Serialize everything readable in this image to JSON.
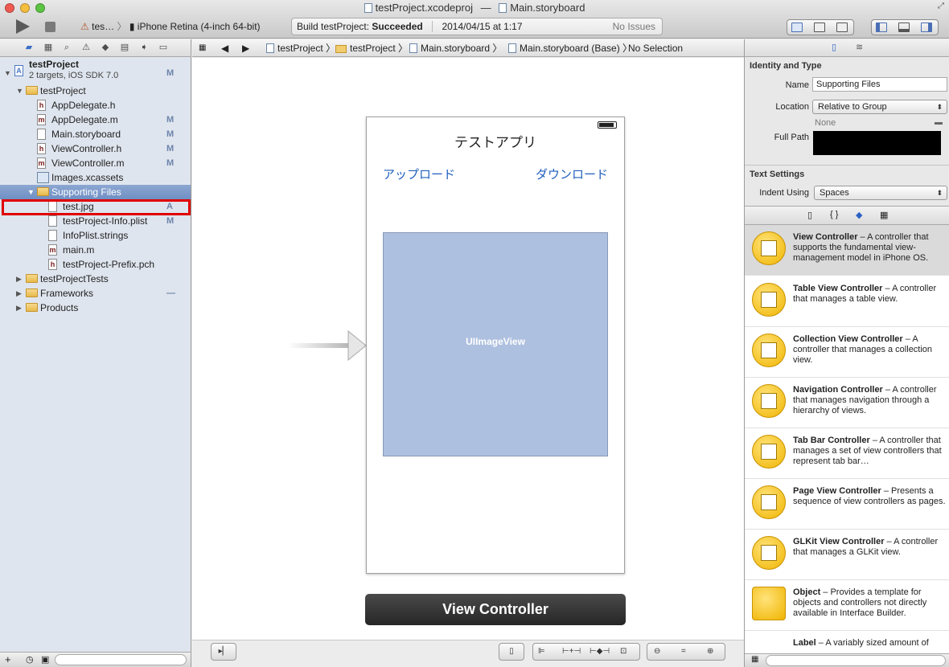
{
  "window": {
    "project_file": "testProject.xcodeproj",
    "separator": "—",
    "storyboard_file": "Main.storyboard"
  },
  "toolbar": {
    "scheme": "tes…",
    "destination": "iPhone Retina (4-inch 64-bit)",
    "status_prefix": "Build testProject: ",
    "status_result": "Succeeded",
    "status_time": "2014/04/15 at 1:17",
    "issues": "No Issues"
  },
  "navigator": {
    "project_name": "testProject",
    "project_sub": "2 targets, iOS SDK 7.0",
    "project_badge": "M",
    "items": [
      {
        "label": "testProject",
        "badge": ""
      },
      {
        "label": "AppDelegate.h",
        "badge": "",
        "icon": "h"
      },
      {
        "label": "AppDelegate.m",
        "badge": "M",
        "icon": "m"
      },
      {
        "label": "Main.storyboard",
        "badge": "M"
      },
      {
        "label": "ViewController.h",
        "badge": "M",
        "icon": "h"
      },
      {
        "label": "ViewController.m",
        "badge": "M",
        "icon": "m"
      },
      {
        "label": "Images.xcassets",
        "badge": ""
      },
      {
        "label": "Supporting Files",
        "badge": ""
      },
      {
        "label": "test.jpg",
        "badge": "A"
      },
      {
        "label": "testProject-Info.plist",
        "badge": "M"
      },
      {
        "label": "InfoPlist.strings",
        "badge": ""
      },
      {
        "label": "main.m",
        "badge": "",
        "icon": "m"
      },
      {
        "label": "testProject-Prefix.pch",
        "badge": "",
        "icon": "h"
      },
      {
        "label": "testProjectTests",
        "badge": ""
      },
      {
        "label": "Frameworks",
        "badge": "—"
      },
      {
        "label": "Products",
        "badge": ""
      }
    ]
  },
  "jumpbar": {
    "crumbs": [
      "testProject",
      "testProject",
      "Main.storyboard",
      "Main.storyboard (Base)",
      "No Selection"
    ]
  },
  "canvas": {
    "nav_title": "テストアプリ",
    "upload": "アップロード",
    "download": "ダウンロード",
    "image_view": "UIImageView",
    "scene_label": "View Controller"
  },
  "inspector": {
    "identity_type": "Identity and Type",
    "name_label": "Name",
    "name_value": "Supporting Files",
    "location_label": "Location",
    "location_value": "Relative to Group",
    "none": "None",
    "full_path_label": "Full Path",
    "text_settings": "Text Settings",
    "indent_label": "Indent Using",
    "indent_value": "Spaces"
  },
  "library": [
    {
      "title": "View Controller",
      "desc": " – A controller that supports the fundamental view-management model in iPhone OS."
    },
    {
      "title": "Table View Controller",
      "desc": " – A controller that manages a table view."
    },
    {
      "title": "Collection View Controller",
      "desc": " – A controller that manages a collection view."
    },
    {
      "title": "Navigation Controller",
      "desc": " – A controller that manages navigation through a hierarchy of views."
    },
    {
      "title": "Tab Bar Controller",
      "desc": " – A controller that manages a set of view controllers that represent tab bar…"
    },
    {
      "title": "Page View Controller",
      "desc": " – Presents a sequence of view controllers as pages."
    },
    {
      "title": "GLKit View Controller",
      "desc": " – A controller that manages a GLKit view."
    },
    {
      "title": "Object",
      "desc": " – Provides a template for objects and controllers not directly available in Interface Builder."
    },
    {
      "title": "Label",
      "desc": " – A variably sized amount of"
    }
  ],
  "library_tabs": [
    "▯",
    "{ }",
    "◆",
    "▦"
  ],
  "colors": {
    "accent": "#1f5fbf",
    "selection": "#7b98c9",
    "highlight": "#e00000"
  }
}
